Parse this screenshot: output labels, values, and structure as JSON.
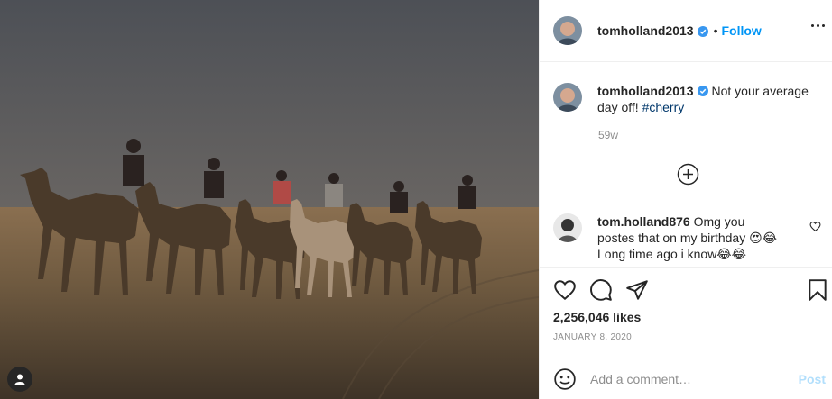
{
  "post": {
    "image_alt_icon": "camel-desert-photo",
    "user_tag_icon": "user-tag-icon"
  },
  "header": {
    "username": "tomholland2013",
    "dot": "•",
    "follow_label": "Follow",
    "more_icon": "more-options-icon",
    "verified_icon": "verified-badge-icon"
  },
  "caption": {
    "username": "tomholland2013",
    "text": " Not your average day off! ",
    "hashtag": "#cherry",
    "time": "59w"
  },
  "load_more_icon": "plus-circle-icon",
  "comments": [
    {
      "username": "tom.holland876",
      "text": " Omg you postes that on my birthday 😍😂Long time ago i know😂😂",
      "like_icon": "heart-outline-icon"
    }
  ],
  "actions": {
    "like_icon": "heart-outline-icon",
    "comment_icon": "comment-bubble-icon",
    "share_icon": "paper-plane-icon",
    "save_icon": "bookmark-icon"
  },
  "likes": "2,256,046 likes",
  "date": "JANUARY 8, 2020",
  "add_comment": {
    "placeholder": "Add a comment…",
    "post_label": "Post",
    "emoji_icon": "smiley-icon"
  },
  "colors": {
    "accent": "#0095f6",
    "post_disabled": "#b2dffc",
    "muted": "#8e8e8e"
  }
}
